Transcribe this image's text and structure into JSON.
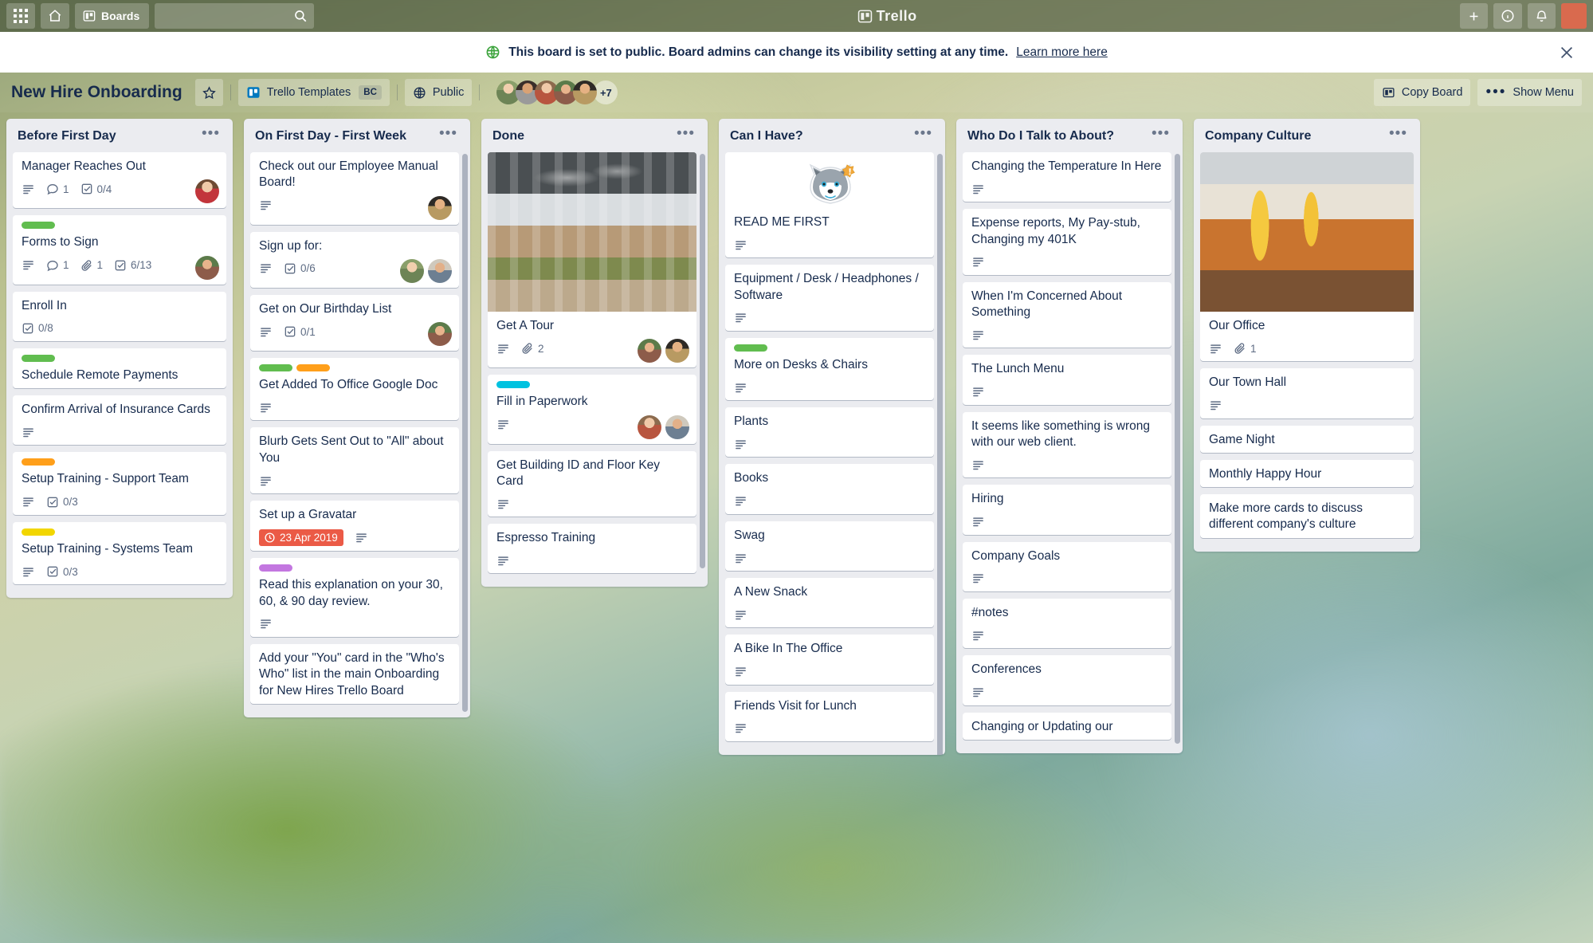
{
  "topbar": {
    "grid_icon": "apps-grid-icon",
    "home_icon": "home-icon",
    "boards_label": "Boards",
    "boards_icon": "board-icon",
    "search_placeholder": "",
    "search_value": "",
    "search_icon": "search-icon",
    "logo_text": "Trello",
    "add_icon": "plus-icon",
    "info_icon": "info-icon",
    "bell_icon": "notification-bell-icon",
    "avatar": "user-avatar"
  },
  "banner": {
    "globe_icon": "globe-public-icon",
    "message": "This board is set to public. Board admins can change its visibility setting at any time.",
    "link_label": "Learn more here",
    "close_icon": "close-icon"
  },
  "board_header": {
    "title": "New Hire Onboarding",
    "star_icon": "star-icon",
    "team_icon": "trello-board-icon",
    "team_name": "Trello Templates",
    "team_badge": "BC",
    "visibility_icon": "globe-icon",
    "visibility_label": "Public",
    "members_overflow": "+7",
    "copy_board_icon": "copy-board-icon",
    "copy_board_label": "Copy Board",
    "show_menu_icon": "ellipsis-icon",
    "show_menu_label": "Show Menu"
  },
  "lists": [
    {
      "title": "Before First Day",
      "menu_icon": "list-actions-icon",
      "cards": [
        {
          "title": "Manager Reaches Out",
          "labels": [],
          "badges": [
            {
              "type": "description",
              "icon": "description-icon",
              "text": ""
            },
            {
              "type": "comments",
              "icon": "comment-icon",
              "text": "1"
            },
            {
              "type": "checklist",
              "icon": "checklist-icon",
              "text": "0/4"
            }
          ],
          "avatars": [
            "f1"
          ]
        },
        {
          "title": "Forms to Sign",
          "labels": [
            "#61bd4f"
          ],
          "badges": [
            {
              "type": "description",
              "icon": "description-icon",
              "text": ""
            },
            {
              "type": "comments",
              "icon": "comment-icon",
              "text": "1"
            },
            {
              "type": "attachment",
              "icon": "attachment-icon",
              "text": "1"
            },
            {
              "type": "checklist",
              "icon": "checklist-icon",
              "text": "6/13"
            }
          ],
          "avatars": [
            "f2"
          ]
        },
        {
          "title": "Enroll In",
          "labels": [],
          "badges": [
            {
              "type": "checklist",
              "icon": "checklist-icon",
              "text": "0/8"
            }
          ],
          "avatars": []
        },
        {
          "title": "Schedule Remote Payments",
          "labels": [
            "#61bd4f"
          ],
          "badges": [],
          "avatars": []
        },
        {
          "title": "Confirm Arrival of Insurance Cards",
          "labels": [],
          "badges": [
            {
              "type": "description",
              "icon": "description-icon",
              "text": ""
            }
          ],
          "avatars": []
        },
        {
          "title": "Setup Training - Support Team",
          "labels": [
            "#ff9f1a"
          ],
          "badges": [
            {
              "type": "description",
              "icon": "description-icon",
              "text": ""
            },
            {
              "type": "checklist",
              "icon": "checklist-icon",
              "text": "0/3"
            }
          ],
          "avatars": []
        },
        {
          "title": "Setup Training - Systems Team",
          "labels": [
            "#f2d600"
          ],
          "badges": [
            {
              "type": "description",
              "icon": "description-icon",
              "text": ""
            },
            {
              "type": "checklist",
              "icon": "checklist-icon",
              "text": "0/3"
            }
          ],
          "avatars": []
        }
      ]
    },
    {
      "title": "On First Day - First Week",
      "menu_icon": "list-actions-icon",
      "cards": [
        {
          "title": "Check out our Employee Manual Board!",
          "labels": [],
          "badges": [
            {
              "type": "description",
              "icon": "description-icon",
              "text": ""
            }
          ],
          "avatars": [
            "f3"
          ]
        },
        {
          "title": "Sign up for:",
          "labels": [],
          "badges": [
            {
              "type": "description",
              "icon": "description-icon",
              "text": ""
            },
            {
              "type": "checklist",
              "icon": "checklist-icon",
              "text": "0/6"
            }
          ],
          "avatars": [
            "f4",
            "f5"
          ]
        },
        {
          "title": "Get on Our Birthday List",
          "labels": [],
          "badges": [
            {
              "type": "description",
              "icon": "description-icon",
              "text": ""
            },
            {
              "type": "checklist",
              "icon": "checklist-icon",
              "text": "0/1"
            }
          ],
          "avatars": [
            "f2"
          ]
        },
        {
          "title": "Get Added To Office Google Doc",
          "labels": [
            "#61bd4f",
            "#ff9f1a"
          ],
          "badges": [
            {
              "type": "description",
              "icon": "description-icon",
              "text": ""
            }
          ],
          "avatars": []
        },
        {
          "title": "Blurb Gets Sent Out to \"All\" about You",
          "labels": [],
          "badges": [
            {
              "type": "description",
              "icon": "description-icon",
              "text": ""
            }
          ],
          "avatars": []
        },
        {
          "title": "Set up a Gravatar",
          "labels": [],
          "badges": [
            {
              "type": "due",
              "icon": "clock-icon",
              "text": "23 Apr 2019"
            },
            {
              "type": "description",
              "icon": "description-icon",
              "text": ""
            }
          ],
          "avatars": []
        },
        {
          "title": "Read this explanation on your 30, 60, & 90 day review.",
          "labels": [
            "#c377e0"
          ],
          "badges": [
            {
              "type": "description",
              "icon": "description-icon",
              "text": ""
            }
          ],
          "avatars": []
        },
        {
          "title": "Add your \"You\" card in the \"Who's Who\" list in the main Onboarding for New Hires Trello Board",
          "labels": [],
          "badges": [],
          "avatars": []
        }
      ]
    },
    {
      "title": "Done",
      "menu_icon": "list-actions-icon",
      "cards": [
        {
          "title": "Get A Tour",
          "cover": "cover-office",
          "labels": [],
          "badges": [
            {
              "type": "description",
              "icon": "description-icon",
              "text": ""
            },
            {
              "type": "attachment",
              "icon": "attachment-icon",
              "text": "2"
            }
          ],
          "avatars": [
            "f2",
            "f3"
          ]
        },
        {
          "title": "Fill in Paperwork",
          "labels": [
            "#00c2e0"
          ],
          "badges": [
            {
              "type": "description",
              "icon": "description-icon",
              "text": ""
            }
          ],
          "avatars": [
            "f8",
            "f5"
          ]
        },
        {
          "title": "Get Building ID and Floor Key Card",
          "labels": [],
          "badges": [
            {
              "type": "description",
              "icon": "description-icon",
              "text": ""
            }
          ],
          "avatars": []
        },
        {
          "title": "Espresso Training",
          "labels": [],
          "badges": [
            {
              "type": "description",
              "icon": "description-icon",
              "text": ""
            }
          ],
          "avatars": []
        }
      ]
    },
    {
      "title": "Can I Have?",
      "menu_icon": "list-actions-icon",
      "cards": [
        {
          "title": "READ ME FIRST",
          "sticker": "husky-alert-sticker",
          "labels": [],
          "badges": [
            {
              "type": "description",
              "icon": "description-icon",
              "text": ""
            }
          ],
          "avatars": []
        },
        {
          "title": "Equipment / Desk / Headphones / Software",
          "labels": [],
          "badges": [
            {
              "type": "description",
              "icon": "description-icon",
              "text": ""
            }
          ],
          "avatars": []
        },
        {
          "title": "More on Desks & Chairs",
          "labels": [
            "#61bd4f"
          ],
          "badges": [
            {
              "type": "description",
              "icon": "description-icon",
              "text": ""
            }
          ],
          "avatars": []
        },
        {
          "title": "Plants",
          "labels": [],
          "badges": [
            {
              "type": "description",
              "icon": "description-icon",
              "text": ""
            }
          ],
          "avatars": []
        },
        {
          "title": "Books",
          "labels": [],
          "badges": [
            {
              "type": "description",
              "icon": "description-icon",
              "text": ""
            }
          ],
          "avatars": []
        },
        {
          "title": "Swag",
          "labels": [],
          "badges": [
            {
              "type": "description",
              "icon": "description-icon",
              "text": ""
            }
          ],
          "avatars": []
        },
        {
          "title": "A New Snack",
          "labels": [],
          "badges": [
            {
              "type": "description",
              "icon": "description-icon",
              "text": ""
            }
          ],
          "avatars": []
        },
        {
          "title": "A Bike In The Office",
          "labels": [],
          "badges": [
            {
              "type": "description",
              "icon": "description-icon",
              "text": ""
            }
          ],
          "avatars": []
        },
        {
          "title": "Friends Visit for Lunch",
          "labels": [],
          "badges": [
            {
              "type": "description",
              "icon": "description-icon",
              "text": ""
            }
          ],
          "avatars": []
        }
      ]
    },
    {
      "title": "Who Do I Talk to About?",
      "menu_icon": "list-actions-icon",
      "cards": [
        {
          "title": "Changing the Temperature In Here",
          "labels": [],
          "badges": [
            {
              "type": "description",
              "icon": "description-icon",
              "text": ""
            }
          ],
          "avatars": []
        },
        {
          "title": "Expense reports, My Pay-stub, Changing my 401K",
          "labels": [],
          "badges": [
            {
              "type": "description",
              "icon": "description-icon",
              "text": ""
            }
          ],
          "avatars": []
        },
        {
          "title": "When I'm Concerned About Something",
          "labels": [],
          "badges": [
            {
              "type": "description",
              "icon": "description-icon",
              "text": ""
            }
          ],
          "avatars": []
        },
        {
          "title": "The Lunch Menu",
          "labels": [],
          "badges": [
            {
              "type": "description",
              "icon": "description-icon",
              "text": ""
            }
          ],
          "avatars": []
        },
        {
          "title": "It seems like something is wrong with our web client.",
          "labels": [],
          "badges": [
            {
              "type": "description",
              "icon": "description-icon",
              "text": ""
            }
          ],
          "avatars": []
        },
        {
          "title": "Hiring",
          "labels": [],
          "badges": [
            {
              "type": "description",
              "icon": "description-icon",
              "text": ""
            }
          ],
          "avatars": []
        },
        {
          "title": "Company Goals",
          "labels": [],
          "badges": [
            {
              "type": "description",
              "icon": "description-icon",
              "text": ""
            }
          ],
          "avatars": []
        },
        {
          "title": "#notes",
          "labels": [],
          "badges": [
            {
              "type": "description",
              "icon": "description-icon",
              "text": ""
            }
          ],
          "avatars": []
        },
        {
          "title": "Conferences",
          "labels": [],
          "badges": [
            {
              "type": "description",
              "icon": "description-icon",
              "text": ""
            }
          ],
          "avatars": []
        },
        {
          "title": "Changing or Updating our",
          "labels": [],
          "badges": [],
          "avatars": []
        }
      ]
    },
    {
      "title": "Company Culture",
      "menu_icon": "list-actions-icon",
      "cards": [
        {
          "title": "Our Office",
          "cover": "cover-lounge",
          "labels": [],
          "badges": [
            {
              "type": "description",
              "icon": "description-icon",
              "text": ""
            },
            {
              "type": "attachment",
              "icon": "attachment-icon",
              "text": "1"
            }
          ],
          "avatars": []
        },
        {
          "title": "Our Town Hall",
          "labels": [],
          "badges": [
            {
              "type": "description",
              "icon": "description-icon",
              "text": ""
            }
          ],
          "avatars": []
        },
        {
          "title": "Game Night",
          "labels": [],
          "badges": [],
          "avatars": []
        },
        {
          "title": "Monthly Happy Hour",
          "labels": [],
          "badges": [],
          "avatars": []
        },
        {
          "title": "Make more cards to discuss different company's culture",
          "labels": [],
          "badges": [],
          "avatars": []
        }
      ]
    }
  ]
}
